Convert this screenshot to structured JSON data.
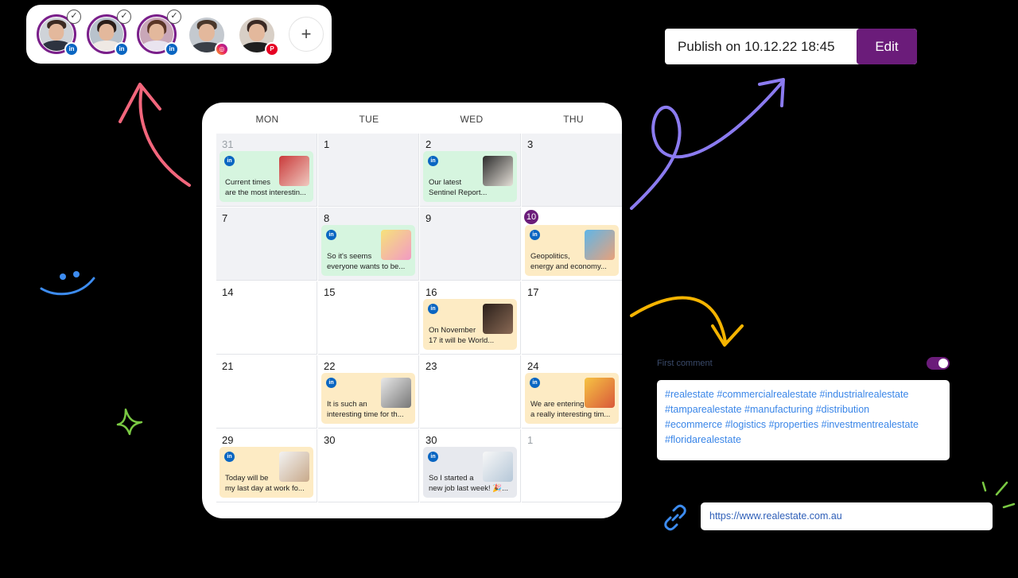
{
  "accounts": [
    {
      "name": "account-1",
      "network": "linkedin",
      "network_glyph": "in",
      "selected": true
    },
    {
      "name": "account-2",
      "network": "linkedin",
      "network_glyph": "in",
      "selected": true
    },
    {
      "name": "account-3",
      "network": "linkedin",
      "network_glyph": "in",
      "selected": true
    },
    {
      "name": "account-4",
      "network": "instagram",
      "network_glyph": "◎",
      "selected": false
    },
    {
      "name": "account-5",
      "network": "pinterest",
      "network_glyph": "P",
      "selected": false
    }
  ],
  "add_account_glyph": "+",
  "check_glyph": "✓",
  "publish": {
    "label": "Publish on 10.12.22 18:45",
    "edit_label": "Edit"
  },
  "calendar": {
    "days": [
      "MON",
      "TUE",
      "WED",
      "THU"
    ],
    "weeks": [
      [
        {
          "day": "31",
          "muted": true,
          "post": {
            "color": "green",
            "lines": [
              "Current times",
              "are the most interestin..."
            ]
          }
        },
        {
          "day": "1"
        },
        {
          "day": "2",
          "post": {
            "color": "green",
            "lines": [
              "Our latest",
              "Sentinel Report..."
            ]
          }
        },
        {
          "day": "3"
        }
      ],
      [
        {
          "day": "7"
        },
        {
          "day": "8",
          "post": {
            "color": "green",
            "lines": [
              "So it's seems",
              "everyone wants to be..."
            ]
          }
        },
        {
          "day": "9"
        },
        {
          "day": "10",
          "today": true,
          "post": {
            "color": "yellow",
            "lines": [
              "Geopolitics,",
              "energy and economy..."
            ]
          }
        }
      ],
      [
        {
          "day": "14"
        },
        {
          "day": "15"
        },
        {
          "day": "16",
          "post": {
            "color": "yellow",
            "lines": [
              "On November",
              "17 it will be World..."
            ]
          }
        },
        {
          "day": "17"
        }
      ],
      [
        {
          "day": "21"
        },
        {
          "day": "22",
          "post": {
            "color": "yellow",
            "lines": [
              "It is such an",
              "interesting time for th..."
            ]
          }
        },
        {
          "day": "23"
        },
        {
          "day": "24",
          "post": {
            "color": "yellow",
            "lines": [
              "We are entering",
              "a really interesting tim..."
            ]
          }
        }
      ],
      [
        {
          "day": "29",
          "post": {
            "color": "yellow",
            "lines": [
              "Today will be",
              "my last day at work fo..."
            ]
          }
        },
        {
          "day": "30"
        },
        {
          "day": "30",
          "post": {
            "color": "grey",
            "lines": [
              "So I started a",
              "new job last week! 🎉..."
            ]
          }
        },
        {
          "day": "1",
          "muted": true
        }
      ]
    ]
  },
  "first_comment": {
    "label": "First comment",
    "enabled": true,
    "lines": [
      "#realestate #commercialrealestate #industrialrealestate",
      "#tamparealestate #manufacturing #distribution",
      "#ecommerce #logistics #properties #investmentrealestate",
      "#floridarealestate"
    ]
  },
  "link": {
    "url": "https://www.realestate.com.au"
  },
  "colors": {
    "accent": "#6b1c7a",
    "linkedin": "#0a66c2",
    "post_green": "#d6f5df",
    "post_yellow": "#fdebc4"
  }
}
